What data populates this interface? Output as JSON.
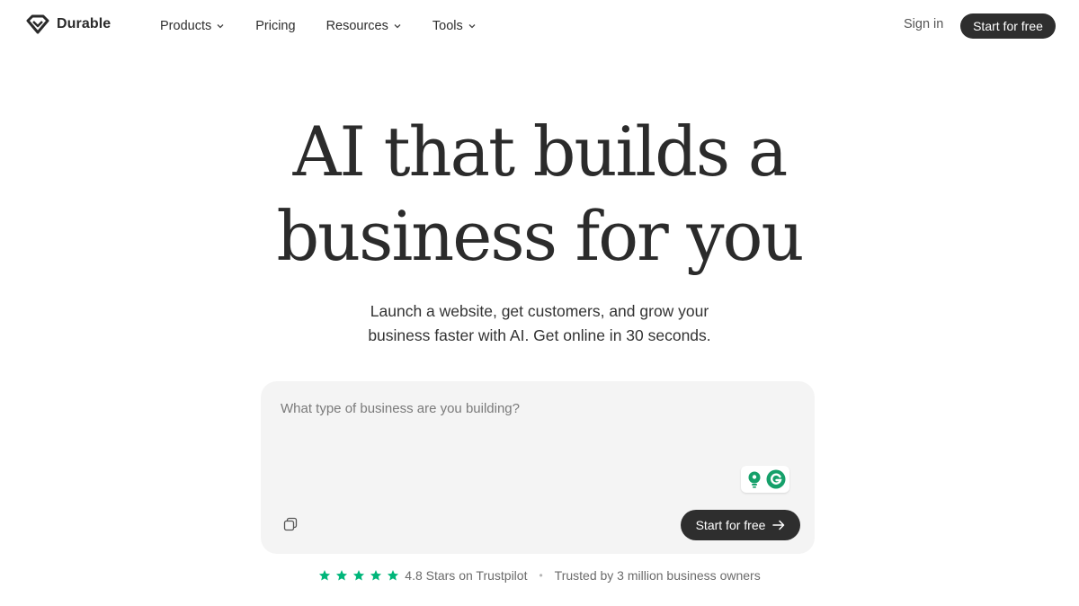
{
  "brand": {
    "name": "Durable",
    "logo_icon": "diamond-logo-icon"
  },
  "nav": {
    "items": [
      {
        "label": "Products",
        "has_dropdown": true
      },
      {
        "label": "Pricing",
        "has_dropdown": false
      },
      {
        "label": "Resources",
        "has_dropdown": true
      },
      {
        "label": "Tools",
        "has_dropdown": true
      }
    ],
    "sign_in": "Sign in",
    "cta": "Start for free"
  },
  "hero": {
    "title_line_1": "AI that builds a",
    "title_line_2": "business for you",
    "subtitle_line_1": "Launch a website, get customers, and grow your",
    "subtitle_line_2": "business faster with AI. Get online in 30 seconds."
  },
  "prompt": {
    "placeholder": "What type of business are you building?",
    "value": "",
    "cta": "Start for free",
    "extension_icons": [
      "lightbulb-icon",
      "grammarly-icon"
    ],
    "attach_icon": "copy-icon"
  },
  "trust": {
    "rating_stars": 5,
    "rating_text": "4.8 Stars on Trustpilot",
    "separator": "•",
    "trusted_text": "Trusted by 3 million business owners"
  },
  "colors": {
    "primary_dark": "#2e2e2e",
    "card_bg": "#f4f4f4",
    "star_green": "#00b67a",
    "grammarly_green": "#15a06a"
  }
}
